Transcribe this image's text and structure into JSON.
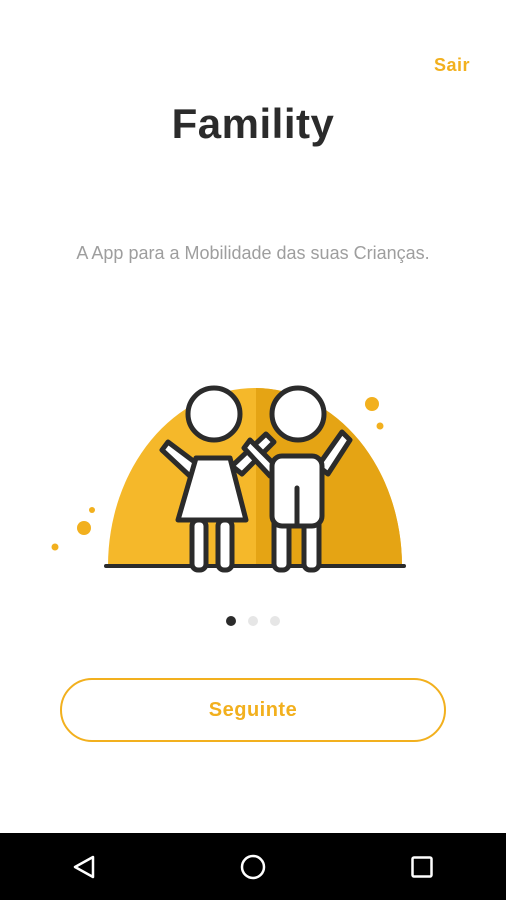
{
  "header": {
    "skip_label": "Sair"
  },
  "onboarding": {
    "title": "Famility",
    "tagline": "A App para a Mobilidade das suas Crianças.",
    "illustration_icon": "two-children-waving-icon",
    "current_page": 1,
    "total_pages": 3
  },
  "actions": {
    "next_label": "Seguinte"
  },
  "navigation_bar": {
    "back_icon": "back-triangle-icon",
    "home_icon": "home-circle-icon",
    "recents_icon": "recents-square-icon"
  },
  "colors": {
    "accent": "#f2b01e",
    "accent_dark": "#e09e10",
    "text_dark": "#2b2b2b",
    "text_muted": "#9e9e9e",
    "nav_bar": "#000000"
  }
}
